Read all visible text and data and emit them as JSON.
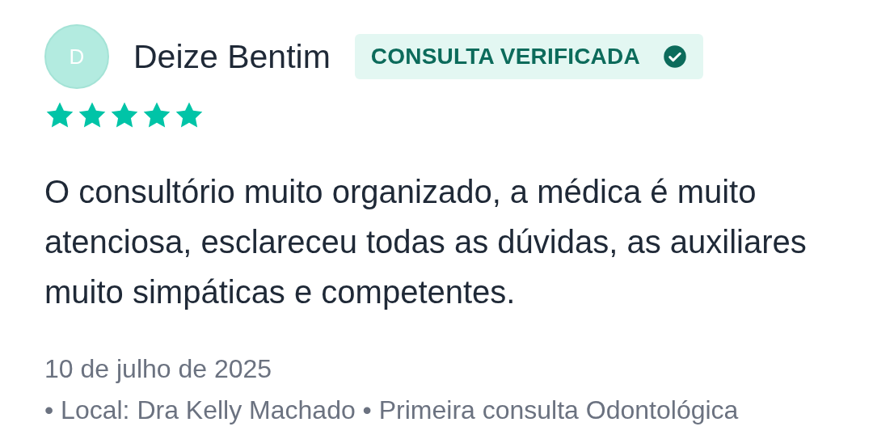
{
  "review": {
    "avatar_initial": "D",
    "author": "Deize Bentim",
    "badge": {
      "label": "CONSULTA VERIFICADA",
      "verified": true
    },
    "stars": 5,
    "text": "O consultório muito organizado, a médica é muito atenciosa, esclareceu todas as dúvidas, as auxiliares muito simpáticas e competentes.",
    "date": "10 de julho de 2025",
    "details": "• Local: Dra Kelly Machado • Primeira consulta Odontológica"
  }
}
